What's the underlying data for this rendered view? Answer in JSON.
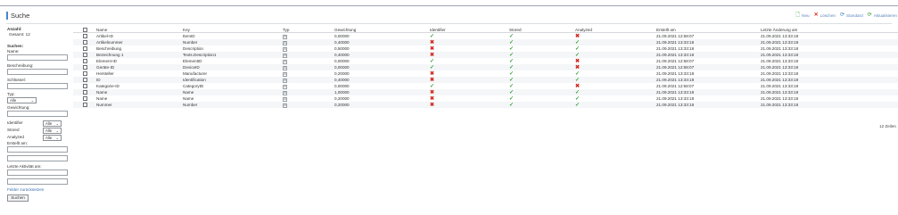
{
  "page": {
    "title": "Suche"
  },
  "toolbar": {
    "new_label": "Neu",
    "delete_label": "Löschen",
    "standard_label": "Standard",
    "update_label": "Aktualisieren"
  },
  "sidebar": {
    "count_heading": "Anzahl:",
    "count_value": "Gesamt: 12",
    "search_heading": "Suchen:",
    "name_label": "Name:",
    "description_label": "Beschreibung:",
    "key_label": "Schlüssel:",
    "type_label": "Typ:",
    "type_value": "Alle",
    "weight_label": "Gewichtung:",
    "identifier_label": "Identifier",
    "identifier_value": "Alle",
    "stored_label": "Stored",
    "stored_value": "Alle",
    "analyzed_label": "Analyzed",
    "analyzed_value": "Alle",
    "created_label": "Erstellt am:",
    "last_activity_label": "Letzte Aktivität am:",
    "reset_link": "Felder zurücksetzen",
    "search_button": "Suchen"
  },
  "table": {
    "headers": {
      "name": "Name",
      "key": "Key",
      "typ": "Typ",
      "gewichtung": "Gewichtung",
      "identifier": "Identifier",
      "stored": "Stored",
      "analyzed": "Analyzed",
      "created": "Erstellt am",
      "changed": "Letzte Änderung am"
    },
    "rows": [
      {
        "name": "Artikel-ID",
        "key": "ItemID",
        "gewichtung": "0,00000",
        "identifier": true,
        "stored": true,
        "analyzed": false,
        "created": "21.09.2021 12:58:07",
        "changed": "21.09.2021 13:33:18"
      },
      {
        "name": "Artikelnummer",
        "key": "Number",
        "gewichtung": "0,40000",
        "identifier": false,
        "stored": true,
        "analyzed": true,
        "created": "21.09.2021 13:33:18",
        "changed": "21.09.2021 13:33:18"
      },
      {
        "name": "Beschreibung",
        "key": "Description",
        "gewichtung": "0,50000",
        "identifier": false,
        "stored": true,
        "analyzed": true,
        "created": "21.09.2021 13:33:18",
        "changed": "21.09.2021 13:33:18"
      },
      {
        "name": "Bezeichnung 1",
        "key": "Texts.Description1",
        "gewichtung": "0,40000",
        "identifier": false,
        "stored": true,
        "analyzed": true,
        "created": "21.09.2021 13:33:18",
        "changed": "21.09.2021 13:33:18"
      },
      {
        "name": "Element-ID",
        "key": "ElementID",
        "gewichtung": "0,00000",
        "identifier": true,
        "stored": true,
        "analyzed": false,
        "created": "21.09.2021 12:58:07",
        "changed": "21.09.2021 13:33:18"
      },
      {
        "name": "Geräte-ID",
        "key": "DeviceID",
        "gewichtung": "0,00000",
        "identifier": true,
        "stored": true,
        "analyzed": false,
        "created": "21.09.2021 12:58:07",
        "changed": "21.09.2021 13:33:18"
      },
      {
        "name": "Hersteller",
        "key": "Manufacturer",
        "gewichtung": "0,20000",
        "identifier": false,
        "stored": true,
        "analyzed": true,
        "created": "21.09.2021 13:33:18",
        "changed": "21.09.2021 13:33:18"
      },
      {
        "name": "ID",
        "key": "Identification",
        "gewichtung": "0,40000",
        "identifier": false,
        "stored": true,
        "analyzed": true,
        "created": "21.09.2021 13:33:18",
        "changed": "21.09.2021 13:33:18"
      },
      {
        "name": "Kategorie-ID",
        "key": "CategoryID",
        "gewichtung": "0,00000",
        "identifier": true,
        "stored": true,
        "analyzed": false,
        "created": "21.09.2021 12:58:07",
        "changed": "21.09.2021 13:33:18"
      },
      {
        "name": "Name",
        "key": "Name",
        "gewichtung": "1,00000",
        "identifier": false,
        "stored": true,
        "analyzed": true,
        "created": "21.09.2021 13:33:18",
        "changed": "21.09.2021 13:33:18"
      },
      {
        "name": "Name",
        "key": "Name",
        "gewichtung": "0,20000",
        "identifier": false,
        "stored": true,
        "analyzed": true,
        "created": "21.09.2021 13:33:18",
        "changed": "21.09.2021 13:33:18"
      },
      {
        "name": "Nummer",
        "key": "Number",
        "gewichtung": "0,20000",
        "identifier": false,
        "stored": true,
        "analyzed": true,
        "created": "21.09.2021 13:33:18",
        "changed": "21.09.2021 13:33:18"
      }
    ],
    "footer": "12 Zeilen"
  },
  "icons": {
    "new": "page-plus-icon",
    "delete": "x-icon",
    "standard": "refresh-icon",
    "update": "refresh-icon",
    "type": "text-type-icon",
    "yes": "check-icon",
    "no": "cross-icon"
  },
  "colors": {
    "accent": "#4a86c5",
    "yes": "#2f9e2f",
    "no": "#d3281e",
    "link": "#3a6fb0"
  }
}
